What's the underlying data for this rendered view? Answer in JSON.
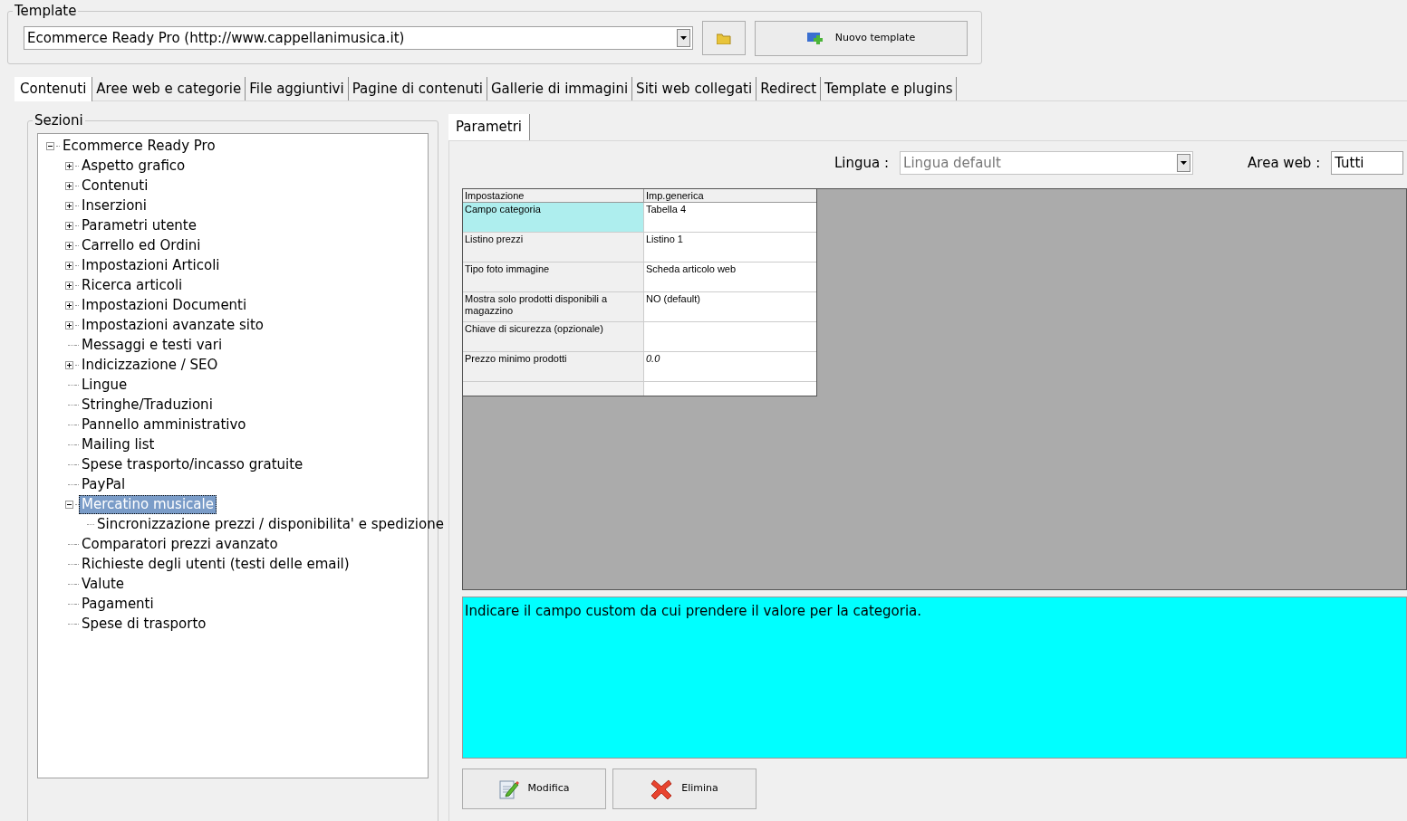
{
  "template": {
    "label": "Template",
    "value": "Ecommerce Ready Pro (http://www.cappellanimusica.it)",
    "new_button": "Nuovo template"
  },
  "tabs": [
    {
      "label": "Contenuti",
      "selected": true
    },
    {
      "label": "Aree web e categorie",
      "selected": false
    },
    {
      "label": "File aggiuntivi",
      "selected": false
    },
    {
      "label": "Pagine di contenuti",
      "selected": false
    },
    {
      "label": "Gallerie di immagini",
      "selected": false
    },
    {
      "label": "Siti web collegati",
      "selected": false
    },
    {
      "label": "Redirect",
      "selected": false
    },
    {
      "label": "Template e plugins",
      "selected": false
    }
  ],
  "sections": {
    "label": "Sezioni",
    "tree": [
      {
        "label": "Ecommerce Ready Pro",
        "expanded": true,
        "selected": false,
        "children": [
          {
            "label": "Aspetto grafico",
            "expanded": false,
            "selected": false
          },
          {
            "label": "Contenuti",
            "expanded": false,
            "selected": false
          },
          {
            "label": "Inserzioni",
            "expanded": false,
            "selected": false
          },
          {
            "label": "Parametri utente",
            "expanded": false,
            "selected": false
          },
          {
            "label": "Carrello ed Ordini",
            "expanded": false,
            "selected": false
          },
          {
            "label": "Impostazioni Articoli",
            "expanded": false,
            "selected": false
          },
          {
            "label": "Ricerca articoli",
            "expanded": false,
            "selected": false
          },
          {
            "label": "Impostazioni Documenti",
            "expanded": false,
            "selected": false
          },
          {
            "label": "Impostazioni avanzate sito",
            "expanded": false,
            "selected": false
          },
          {
            "label": "Messaggi e testi vari",
            "selected": false
          },
          {
            "label": "Indicizzazione / SEO",
            "expanded": false,
            "selected": false
          },
          {
            "label": "Lingue",
            "selected": false
          },
          {
            "label": "Stringhe/Traduzioni",
            "selected": false
          },
          {
            "label": "Pannello amministrativo",
            "selected": false
          },
          {
            "label": "Mailing list",
            "selected": false
          },
          {
            "label": "Spese trasporto/incasso gratuite",
            "selected": false
          },
          {
            "label": "PayPal",
            "selected": false
          },
          {
            "label": "Mercatino musicale",
            "expanded": true,
            "selected": true,
            "children": [
              {
                "label": "Sincronizzazione prezzi / disponibilita' e spedizione",
                "selected": false
              }
            ]
          },
          {
            "label": "Comparatori prezzi avanzato",
            "selected": false
          },
          {
            "label": "Richieste degli utenti (testi delle email)",
            "selected": false
          },
          {
            "label": "Valute",
            "selected": false
          },
          {
            "label": "Pagamenti",
            "selected": false
          },
          {
            "label": "Spese di trasporto",
            "selected": false
          }
        ]
      }
    ]
  },
  "panel_tabs": [
    {
      "label": "Parametri",
      "selected": true
    }
  ],
  "filters": {
    "lingua_label": "Lingua :",
    "lingua_value": "Lingua default",
    "area_label": "Area web :",
    "area_value": "Tutti"
  },
  "table": {
    "columns": [
      "Impostazione",
      "Imp.generica"
    ],
    "rows": [
      {
        "setting": "Campo categoria",
        "value": "Tabella 4",
        "selected": true
      },
      {
        "setting": "Listino prezzi",
        "value": "Listino 1",
        "selected": false
      },
      {
        "setting": "Tipo foto immagine",
        "value": "Scheda articolo web",
        "selected": false
      },
      {
        "setting": "Mostra solo prodotti disponibili a magazzino",
        "value": "NO (default)",
        "selected": false
      },
      {
        "setting": "Chiave di sicurezza (opzionale)",
        "selected": false
      },
      {
        "setting": "Prezzo minimo prodotti",
        "value": "0.0",
        "selected": false,
        "italic": true
      }
    ]
  },
  "description": "Indicare il campo custom da cui prendere il valore per la categoria.",
  "buttons": [
    {
      "label": "Modifica",
      "kind": "edit"
    },
    {
      "label": "Elimina",
      "kind": "delete"
    }
  ]
}
